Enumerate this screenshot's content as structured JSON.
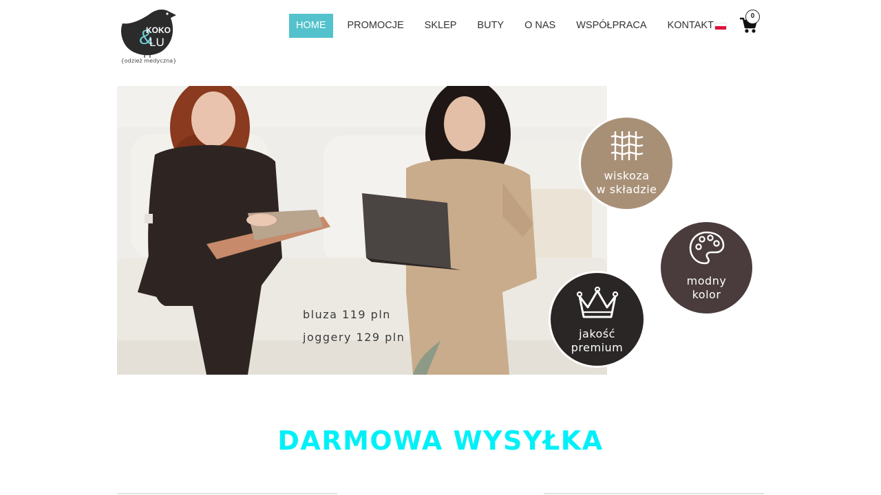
{
  "brand": {
    "logo_top": "KOKO",
    "logo_amp": "&",
    "logo_bottom": "LU",
    "tagline": "{odzież medyczna}"
  },
  "nav": {
    "items": [
      {
        "label": "HOME",
        "active": true
      },
      {
        "label": "PROMOCJE",
        "active": false
      },
      {
        "label": "SKLEP",
        "active": false
      },
      {
        "label": "BUTY",
        "active": false
      },
      {
        "label": "O NAS",
        "active": false
      },
      {
        "label": "WSPÓŁPRACA",
        "active": false
      },
      {
        "label": "KONTAKT",
        "active": false
      }
    ],
    "language_flag": "poland-flag-icon",
    "cart_icon": "shopping-cart-icon",
    "cart_count": "0"
  },
  "hero": {
    "price_top": "bluza 119 pln",
    "price_bottom": "joggery 129 pln",
    "badges": [
      {
        "line1": "wiskoza",
        "line2": "w składzie",
        "icon": "fabric-weave-icon",
        "color": "#a89077"
      },
      {
        "line1": "modny",
        "line2": "kolor",
        "icon": "palette-icon",
        "color": "#4a3c3c"
      },
      {
        "line1": "jakość",
        "line2": "premium",
        "icon": "crown-icon",
        "color": "#2a2625"
      }
    ]
  },
  "shipping": {
    "label": "DARMOWA WYSYŁKA",
    "color": "#00f0f8"
  },
  "colors": {
    "accent": "#54c2cc",
    "text": "#333333"
  }
}
